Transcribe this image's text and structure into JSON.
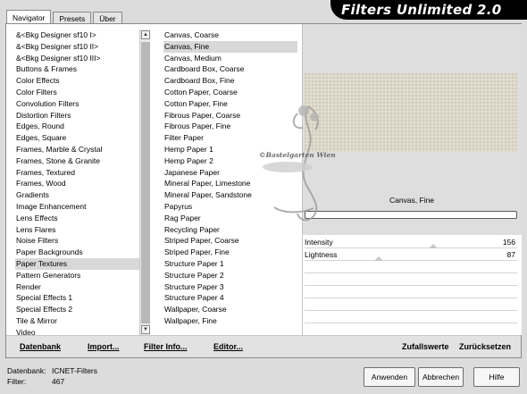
{
  "tabs": [
    "Navigator",
    "Presets",
    "Über"
  ],
  "app_title": "Filters Unlimited 2.0",
  "categories": [
    "&<Bkg Designer sf10 I>",
    "&<Bkg Designer sf10 II>",
    "&<Bkg Designer sf10 III>",
    "Buttons & Frames",
    "Color Effects",
    "Color Filters",
    "Convolution Filters",
    "Distortion Filters",
    "Edges, Round",
    "Edges, Square",
    "Frames, Marble & Crystal",
    "Frames, Stone & Granite",
    "Frames, Textured",
    "Frames, Wood",
    "Gradients",
    "Image Enhancement",
    "Lens Effects",
    "Lens Flares",
    "Noise Filters",
    "Paper Backgrounds",
    "Paper Textures",
    "Pattern Generators",
    "Render",
    "Special Effects 1",
    "Special Effects 2",
    "Tile & Mirror",
    "Video"
  ],
  "selected_category": "Paper Textures",
  "filters": [
    "Canvas, Coarse",
    "Canvas, Fine",
    "Canvas, Medium",
    "Cardboard Box, Coarse",
    "Cardboard Box, Fine",
    "Cotton Paper, Coarse",
    "Cotton Paper, Fine",
    "Fibrous Paper, Coarse",
    "Fibrous Paper, Fine",
    "Filter Paper",
    "Hemp Paper 1",
    "Hemp Paper 2",
    "Japanese Paper",
    "Mineral Paper, Limestone",
    "Mineral Paper, Sandstone",
    "Papyrus",
    "Rag Paper",
    "Recycling Paper",
    "Striped Paper, Coarse",
    "Striped Paper, Fine",
    "Structure Paper 1",
    "Structure Paper 2",
    "Structure Paper 3",
    "Structure Paper 4",
    "Wallpaper, Coarse",
    "Wallpaper, Fine"
  ],
  "selected_filter": "Canvas, Fine",
  "preview_label": "Canvas, Fine",
  "watermark": "©Bastelgarten Wien",
  "sliders": [
    {
      "label": "Intensity",
      "value": "156",
      "level": 0.61
    },
    {
      "label": "Lightness",
      "value": "87",
      "level": 0.34
    }
  ],
  "toolbar": {
    "database": "Datenbank",
    "import": "Import...",
    "filter_info": "Filter Info...",
    "editor": "Editor...",
    "random": "Zufallswerte",
    "reset": "Zurücksetzen"
  },
  "status": {
    "database_label": "Datenbank:",
    "database_value": "ICNET-Filters",
    "filters_label": "Filter:",
    "filters_value": "467"
  },
  "buttons": {
    "apply": "Anwenden",
    "cancel": "Abbrechen",
    "help": "Hilfe"
  },
  "colors": {
    "preview_canvas": "#ddd7c9",
    "banner": "#000000"
  }
}
